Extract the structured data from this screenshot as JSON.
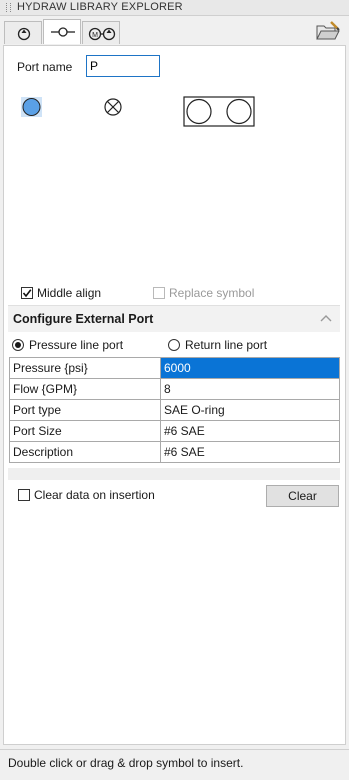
{
  "window": {
    "title": "HYDRAW LIBRARY EXPLORER"
  },
  "tabs": [
    {
      "name": "tab-pump",
      "icon": "pump-symbol-icon",
      "active": false
    },
    {
      "name": "tab-port",
      "icon": "port-symbol-icon",
      "active": true
    },
    {
      "name": "tab-motor-pump",
      "icon": "motor-pump-symbol-icon",
      "active": false
    }
  ],
  "port_name": {
    "label": "Port name",
    "value": "P"
  },
  "symbols": [
    "filled-circle-port-icon",
    "plugged-port-icon",
    "double-port-icon"
  ],
  "options": {
    "middle_align": "Middle align",
    "middle_align_checked": true,
    "replace_symbol": "Replace symbol",
    "replace_symbol_checked": false
  },
  "section": {
    "title": "Configure External Port"
  },
  "port_type": {
    "pressure": "Pressure line port",
    "return": "Return line port",
    "selected": "pressure"
  },
  "properties": [
    {
      "key": "Pressure {psi}",
      "value": "6000",
      "selected": true
    },
    {
      "key": "Flow {GPM}",
      "value": "8",
      "selected": false
    },
    {
      "key": "Port type",
      "value": "SAE O-ring",
      "selected": false
    },
    {
      "key": "Port Size",
      "value": "#6 SAE",
      "selected": false
    },
    {
      "key": "Description",
      "value": "#6 SAE",
      "selected": false
    }
  ],
  "clear_data": {
    "label": "Clear data on insertion",
    "checked": false
  },
  "clear_button": "Clear",
  "status": "Double click or drag & drop symbol to insert.",
  "colors": {
    "accent": "#0a74d6",
    "symbol_fill": "#5aa0e6"
  }
}
